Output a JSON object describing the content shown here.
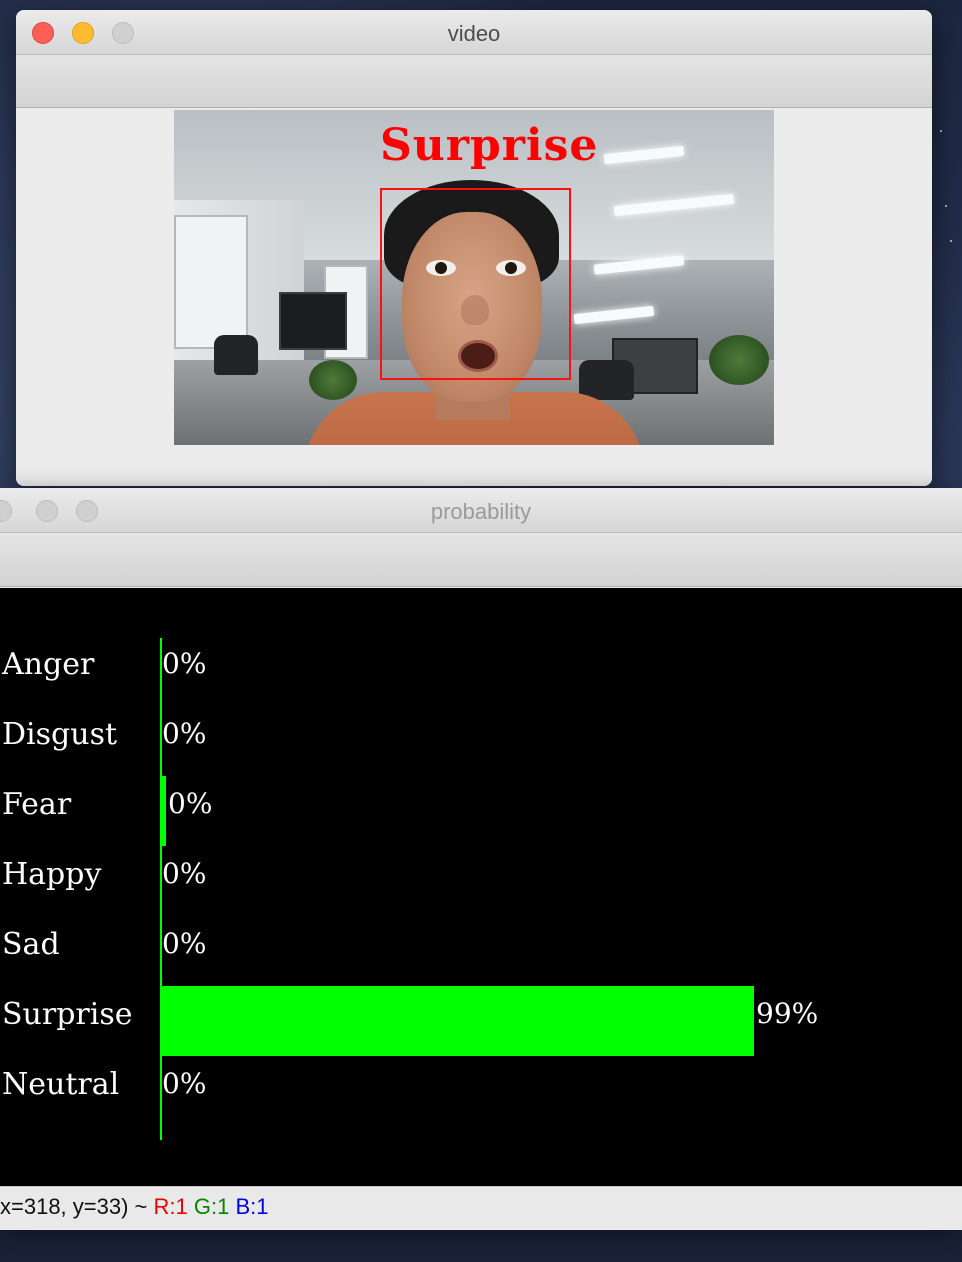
{
  "video_window": {
    "title": "video",
    "detected_emotion": "Surprise"
  },
  "probability_window": {
    "title": "probability",
    "rows": [
      {
        "label": "Anger",
        "value_text": "0%",
        "value": 0
      },
      {
        "label": "Disgust",
        "value_text": "0%",
        "value": 0
      },
      {
        "label": "Fear",
        "value_text": "0%",
        "value": 1
      },
      {
        "label": "Happy",
        "value_text": "0%",
        "value": 0
      },
      {
        "label": "Sad",
        "value_text": "0%",
        "value": 0
      },
      {
        "label": "Surprise",
        "value_text": "99%",
        "value": 99
      },
      {
        "label": "Neutral",
        "value_text": "0%",
        "value": 0
      }
    ],
    "bar_color": "#00ff00",
    "status": {
      "coords": "x=318, y=33) ~",
      "r": "R:1",
      "g": "G:1",
      "b": "B:1"
    }
  },
  "colors": {
    "detection_box": "#ff0000",
    "status_r": "#ee0000",
    "status_g": "#008800",
    "status_b": "#0000ee"
  }
}
